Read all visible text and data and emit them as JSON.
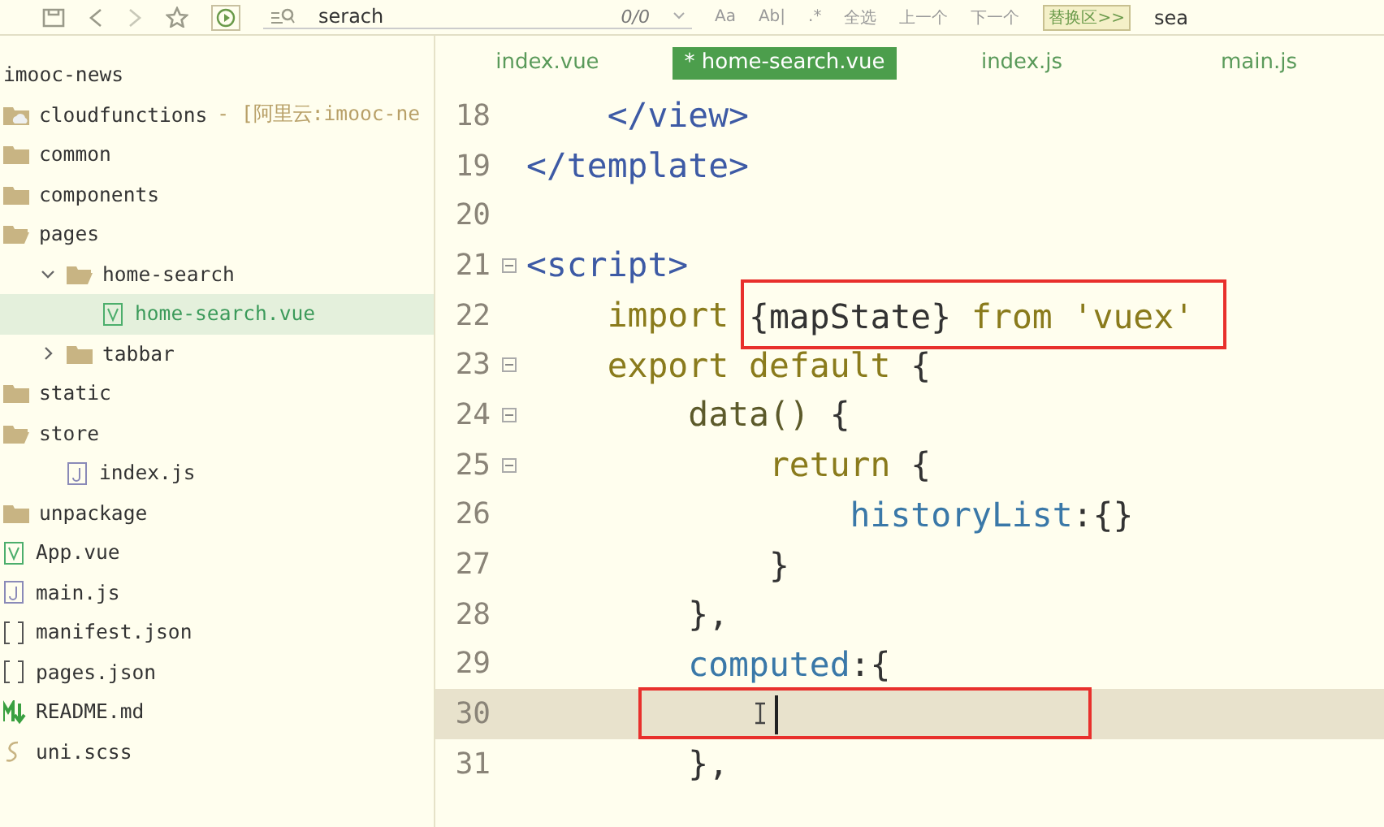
{
  "toolbar": {
    "search": {
      "value": "serach"
    },
    "match_count": "0/0",
    "options": [
      "Aa",
      "Ab|",
      ".*"
    ],
    "actions": [
      "全选",
      "上一个",
      "下一个"
    ],
    "replace_toggle": "替换区>>",
    "replace_field": {
      "value": "sea"
    }
  },
  "sidebar": {
    "root": "imooc-news",
    "items": [
      {
        "label": "cloudfunctions",
        "suffix": "- [阿里云:imooc-ne",
        "kind": "cloud-folder",
        "selected": false
      },
      {
        "label": "common",
        "kind": "folder",
        "expanded": false,
        "selected": false
      },
      {
        "label": "components",
        "kind": "folder",
        "expanded": false,
        "selected": false
      },
      {
        "label": "pages",
        "kind": "folder",
        "expanded": true,
        "selected": false,
        "children": [
          {
            "label": "home-search",
            "kind": "folder",
            "expanded": true,
            "selected": false,
            "children": [
              {
                "label": "home-search.vue",
                "kind": "vue",
                "selected": true
              }
            ]
          },
          {
            "label": "tabbar",
            "kind": "folder",
            "expanded": false,
            "selected": false
          }
        ]
      },
      {
        "label": "static",
        "kind": "folder",
        "expanded": false,
        "selected": false
      },
      {
        "label": "store",
        "kind": "folder",
        "expanded": true,
        "selected": false,
        "children": [
          {
            "label": "index.js",
            "kind": "js",
            "selected": false
          }
        ]
      },
      {
        "label": "unpackage",
        "kind": "folder",
        "expanded": false,
        "selected": false
      },
      {
        "label": "App.vue",
        "kind": "vue",
        "selected": false
      },
      {
        "label": "main.js",
        "kind": "js",
        "selected": false
      },
      {
        "label": "manifest.json",
        "kind": "json",
        "selected": false
      },
      {
        "label": "pages.json",
        "kind": "json",
        "selected": false
      },
      {
        "label": "README.md",
        "kind": "md",
        "selected": false
      },
      {
        "label": "uni.scss",
        "kind": "scss",
        "selected": false
      }
    ]
  },
  "tabs": [
    {
      "label": "index.vue",
      "selected": false
    },
    {
      "label": "* home-search.vue",
      "selected": true
    },
    {
      "label": "index.js",
      "selected": false
    },
    {
      "label": "main.js",
      "selected": false
    }
  ],
  "editor": {
    "lines": [
      {
        "number": "18",
        "foldable": false,
        "current": false,
        "segments": [
          {
            "kind": "tag",
            "text": "    </view>"
          }
        ]
      },
      {
        "number": "19",
        "foldable": false,
        "current": false,
        "segments": [
          {
            "kind": "tag",
            "text": "</template>"
          }
        ]
      },
      {
        "number": "20",
        "foldable": false,
        "current": false
      },
      {
        "number": "21",
        "foldable": true,
        "current": false,
        "segments": [
          {
            "kind": "tag",
            "text": "<script>"
          }
        ]
      },
      {
        "number": "22",
        "foldable": false,
        "current": false,
        "segments": [
          {
            "kind": "keyword",
            "text": "    import "
          },
          {
            "kind": "plain",
            "text": "{mapState} ",
            "boxed": true
          },
          {
            "kind": "keyword",
            "text": "from ",
            "boxed": true
          },
          {
            "kind": "string",
            "text": "'vuex'",
            "boxed": true
          }
        ]
      },
      {
        "number": "23",
        "foldable": true,
        "current": false,
        "segments": [
          {
            "kind": "keyword",
            "text": "    export default"
          },
          {
            "kind": "plain",
            "text": " {"
          }
        ]
      },
      {
        "number": "24",
        "foldable": true,
        "current": false,
        "segments": [
          {
            "kind": "function",
            "text": "        data()"
          },
          {
            "kind": "plain",
            "text": " {"
          }
        ]
      },
      {
        "number": "25",
        "foldable": true,
        "current": false,
        "segments": [
          {
            "kind": "keyword",
            "text": "            return"
          },
          {
            "kind": "plain",
            "text": " {"
          }
        ]
      },
      {
        "number": "26",
        "foldable": false,
        "current": false,
        "segments": [
          {
            "kind": "property",
            "text": "                historyList"
          },
          {
            "kind": "plain",
            "text": ":{}"
          }
        ]
      },
      {
        "number": "27",
        "foldable": false,
        "current": false,
        "segments": [
          {
            "kind": "plain",
            "text": "            }"
          }
        ]
      },
      {
        "number": "28",
        "foldable": false,
        "current": false,
        "segments": [
          {
            "kind": "plain",
            "text": "        },"
          }
        ]
      },
      {
        "number": "29",
        "foldable": false,
        "current": false,
        "segments": [
          {
            "kind": "property",
            "text": "        computed"
          },
          {
            "kind": "plain",
            "text": ":{"
          }
        ]
      },
      {
        "number": "30",
        "foldable": false,
        "current": true
      },
      {
        "number": "31",
        "foldable": false,
        "current": false,
        "segments": [
          {
            "kind": "plain",
            "text": "        },"
          }
        ]
      }
    ],
    "annotations": [
      {
        "kind": "rectangle"
      }
    ]
  }
}
